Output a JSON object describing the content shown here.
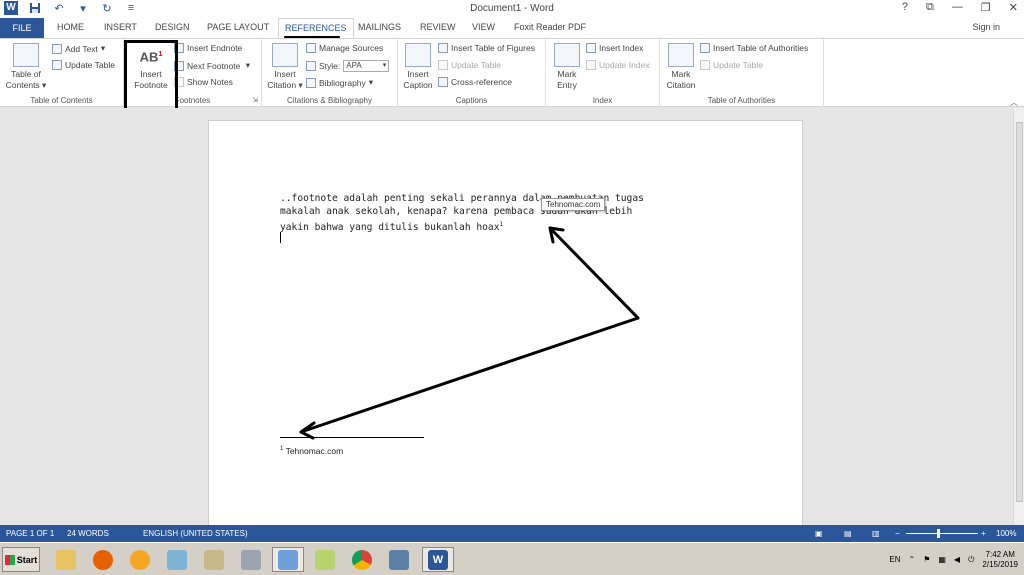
{
  "window": {
    "title": "Document1 - Word",
    "help": "?",
    "restore": "⧉",
    "minimize": "—",
    "maximize": "❐",
    "close": "✕",
    "sign_in": "Sign in"
  },
  "qat": {
    "undo": "↶",
    "redo": "↻",
    "more": "▾"
  },
  "tabs": {
    "file": "FILE",
    "home": "HOME",
    "insert": "INSERT",
    "design": "DESIGN",
    "page_layout": "PAGE LAYOUT",
    "references": "REFERENCES",
    "mailings": "MAILINGS",
    "review": "REVIEW",
    "view": "VIEW",
    "foxit": "Foxit Reader PDF"
  },
  "ribbon": {
    "toc": {
      "button": "Table of Contents",
      "add_text": "Add Text",
      "update_table": "Update Table",
      "group": "Table of Contents"
    },
    "footnotes": {
      "insert_footnote_l1": "Insert",
      "insert_footnote_l2": "Footnote",
      "icon_text": "AB",
      "insert_endnote": "Insert Endnote",
      "next_footnote": "Next Footnote",
      "show_notes": "Show Notes",
      "group": "Footnotes"
    },
    "citations": {
      "insert_citation_l1": "Insert",
      "insert_citation_l2": "Citation",
      "manage_sources": "Manage Sources",
      "style_label": "Style:",
      "style_value": "APA",
      "bibliography": "Bibliography",
      "group": "Citations & Bibliography"
    },
    "captions": {
      "insert_caption_l1": "Insert",
      "insert_caption_l2": "Caption",
      "insert_table_of_figures": "Insert Table of Figures",
      "update_table": "Update Table",
      "cross_reference": "Cross-reference",
      "group": "Captions"
    },
    "index": {
      "mark_entry_l1": "Mark",
      "mark_entry_l2": "Entry",
      "insert_index": "Insert Index",
      "update_index": "Update Index",
      "group": "Index"
    },
    "toa": {
      "mark_citation_l1": "Mark",
      "mark_citation_l2": "Citation",
      "insert_toa": "Insert Table of Authorities",
      "update_table": "Update Table",
      "group": "Table of Authorities"
    }
  },
  "document": {
    "line1": "..footnote adalah penting sekali perannya dalam pembuatan tugas",
    "line2": "makalah anak sekolah, kenapa? karena pembaca sudah akan lebih",
    "line3": "yakin bahwa yang ditulis bukanlah hoax",
    "footnote_ref": "1",
    "tooltip": "Tehnomac.com",
    "footnote_number": "1",
    "footnote_text": "Tehnomac.com"
  },
  "status": {
    "page": "PAGE 1 OF 1",
    "words": "24 WORDS",
    "language": "ENGLISH (UNITED STATES)",
    "zoom_minus": "−",
    "zoom_plus": "+",
    "zoom": "100%"
  },
  "taskbar": {
    "start": "Start",
    "language": "EN",
    "time": "7:42 AM",
    "date": "2/15/2019"
  },
  "colors": {
    "word_blue": "#2b579a",
    "page_bg": "#ffffff",
    "canvas_bg": "#e6e6e6"
  }
}
